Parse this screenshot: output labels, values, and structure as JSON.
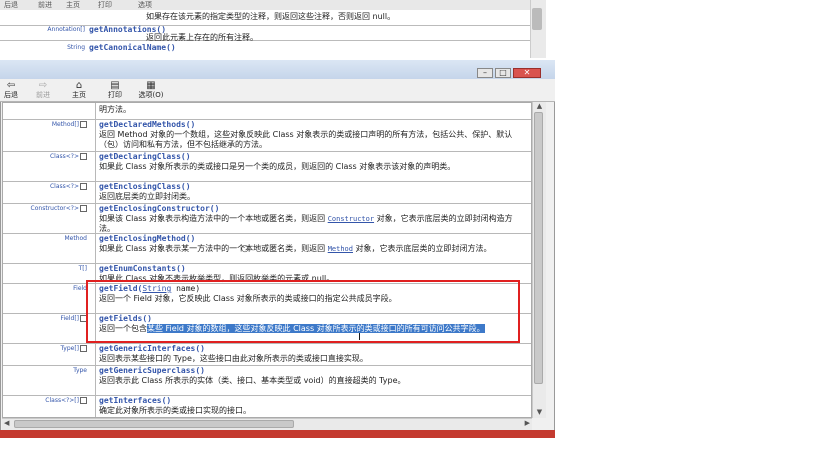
{
  "background_window": {
    "toolbar": [
      "后退",
      "前进",
      "主页",
      "打印",
      "选项"
    ],
    "rows": [
      {
        "type": "",
        "method": "",
        "desc": "如果存在该元素的指定类型的注释，则返回这些注释，否则返回 null。"
      },
      {
        "type": "Annotation[]",
        "method": "getAnnotations()",
        "desc": "返回此元素上存在的所有注释。"
      },
      {
        "type": "String",
        "method": "getCanonicalName()",
        "desc": ""
      }
    ]
  },
  "window": {
    "buttons": {
      "minimize": "–",
      "maximize": "□",
      "close": "✕"
    },
    "toolbar": [
      {
        "icon": "back-arrow-icon",
        "glyph": "⇦",
        "label": "后退"
      },
      {
        "icon": "forward-arrow-icon",
        "glyph": "⇨",
        "label": "前进"
      },
      {
        "icon": "home-icon",
        "glyph": "⌂",
        "label": "主页"
      },
      {
        "icon": "print-icon",
        "glyph": "▤",
        "label": "打印"
      },
      {
        "icon": "options-icon",
        "glyph": "▦",
        "label": "选项(O)"
      }
    ]
  },
  "rows": [
    {
      "type": "",
      "method": "",
      "desc": "明方法。"
    },
    {
      "type": "Method[]",
      "method": "getDeclaredMethods()",
      "desc": "返回 Method 对象的一个数组，这些对象反映此 Class 对象表示的类或接口声明的所有方法，包括公共、保护、默认（包）访问和私有方法，但不包括继承的方法。"
    },
    {
      "type": "Class<?>",
      "method": "getDeclaringClass()",
      "desc": "如果此 Class 对象所表示的类或接口是另一个类的成员，则返回的 Class 对象表示该对象的声明类。"
    },
    {
      "type": "Class<?>",
      "method": "getEnclosingClass()",
      "desc": "返回底层类的立即封闭类。"
    },
    {
      "type": "Constructor<?>",
      "method": "getEnclosingConstructor()",
      "desc_a": "如果该 Class 对象表示构造方法中的一个本地或匿名类，则返回",
      "desc_link": "Constructor",
      "desc_b": "对象，它表示底层类的立即封闭构造方法。"
    },
    {
      "type": "Method",
      "method": "getEnclosingMethod()",
      "desc_a": "如果此 Class 对象表示某一方法中的一个本地或匿名类，则返回",
      "desc_link": "Method",
      "desc_b": "对象，它表示底层类的立即封闭方法。"
    },
    {
      "type": "T[]",
      "method": "getEnumConstants()",
      "desc": "如果此 Class 对象不表示枚举类型，则返回枚举类的元素或 null。"
    },
    {
      "type": "Field",
      "method": "getField(",
      "method_arg_type": "String",
      "method_arg": " name)",
      "desc": "返回一个 Field 对象，它反映此 Class 对象所表示的类或接口的指定公共成员字段。"
    },
    {
      "type": "Field[]",
      "method": "getFields()",
      "desc_plain": "返回一个包含",
      "desc_highlight": "某些 Field 对象的数组，这些对象反映此 Class 对象所表示的类或接口的所有可访问公共字段。"
    },
    {
      "type": "Type[]",
      "method": "getGenericInterfaces()",
      "desc": "返回表示某些接口的 Type，这些接口由此对象所表示的类或接口直接实现。"
    },
    {
      "type": "Type",
      "method": "getGenericSuperclass()",
      "desc": "返回表示此 Class 所表示的实体（类、接口、基本类型或 void）的直接超类的 Type。"
    },
    {
      "type": "Class<?>[]",
      "method": "getInterfaces()",
      "desc": "确定此对象所表示的类或接口实现的接口。"
    }
  ]
}
